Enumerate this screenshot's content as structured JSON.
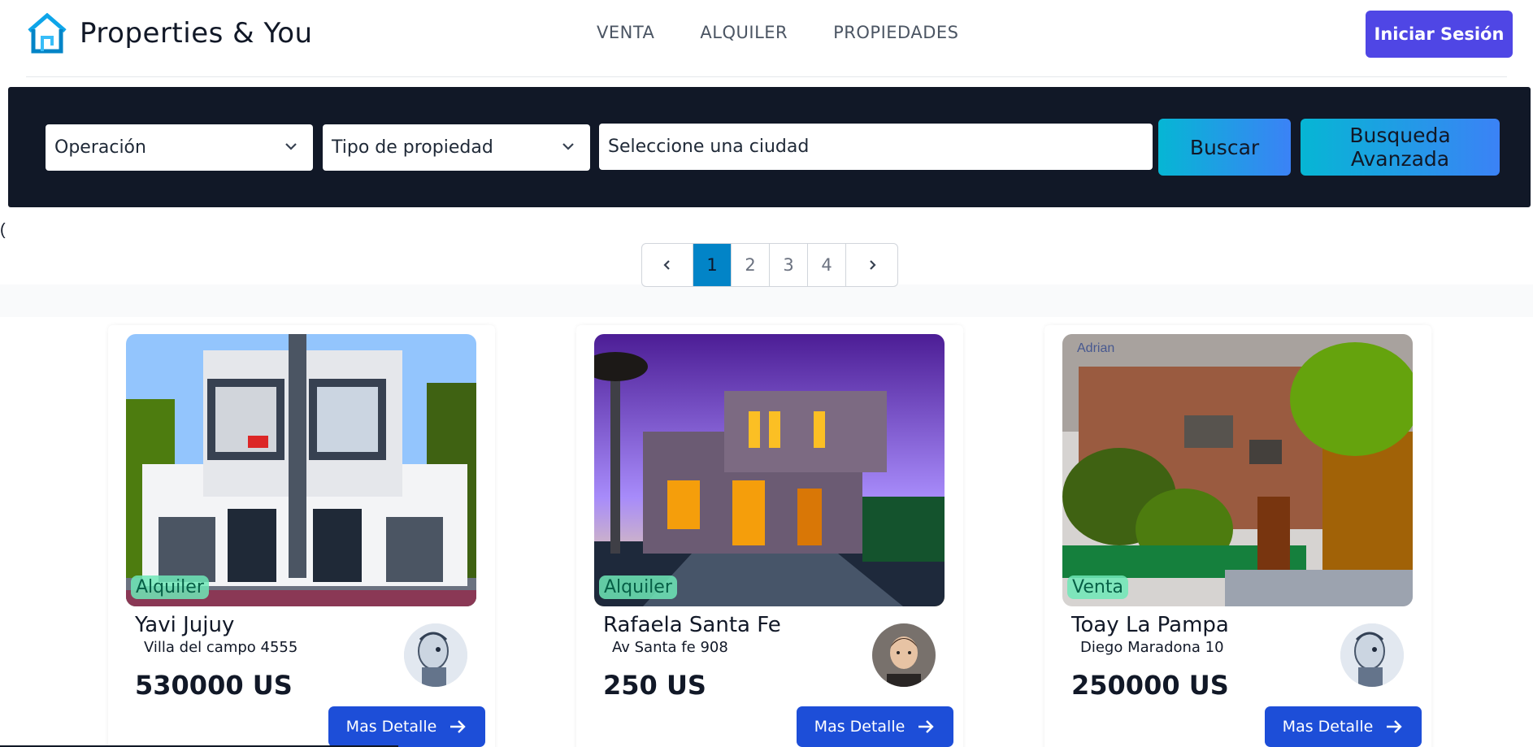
{
  "header": {
    "brand": "Properties & You",
    "nav": [
      "VENTA",
      "ALQUILER",
      "PROPIEDADES"
    ],
    "login_label": "Iniciar Sesión",
    "accent": "#4f46e5"
  },
  "search": {
    "operation_value": "Operación",
    "property_type_value": "Tipo de propiedad",
    "city_placeholder": "Seleccione una ciudad",
    "search_label": "Buscar",
    "advanced_label": "Busqueda Avanzada"
  },
  "stray": {
    "open": "(",
    "close": ")"
  },
  "pagination": {
    "pages": [
      "1",
      "2",
      "3",
      "4"
    ],
    "current": "1"
  },
  "cards": [
    {
      "operation": "Alquiler",
      "city": "Yavi Jujuy",
      "address": "Villa del campo 4555",
      "price": "530000 US",
      "cta": "Mas Detalle",
      "image": "modern-white-house",
      "avatar": "robot-avatar"
    },
    {
      "operation": "Alquiler",
      "city": "Rafaela Santa Fe",
      "address": "Av Santa fe 908",
      "price": "250 US",
      "cta": "Mas Detalle",
      "image": "house-at-dusk",
      "avatar": "person-avatar"
    },
    {
      "operation": "Venta",
      "city": "Toay La Pampa",
      "address": "Diego Maradona 10",
      "price": "250000 US",
      "cta": "Mas Detalle",
      "image": "brick-house-garden",
      "avatar": "robot-avatar"
    }
  ]
}
